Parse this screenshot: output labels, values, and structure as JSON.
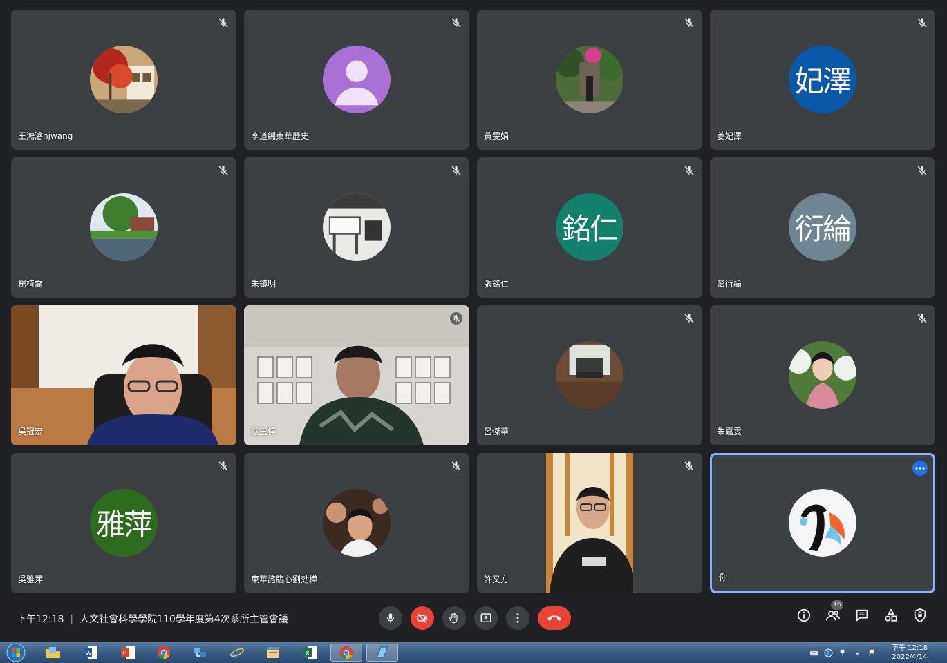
{
  "participants": [
    {
      "name": "王鴻濬hjwang",
      "muted": true,
      "avatar": "photo-tree-house"
    },
    {
      "name": "李道緗東華歷史",
      "muted": true,
      "avatar": "default-person",
      "color": "#a970d6"
    },
    {
      "name": "黃雯娟",
      "muted": true,
      "avatar": "photo-garden-person"
    },
    {
      "name": "姜妃澤",
      "muted": true,
      "initials": "妃澤",
      "color": "#0b57a8"
    },
    {
      "name": "楊植喬",
      "muted": true,
      "avatar": "photo-river-house"
    },
    {
      "name": "朱鎮明",
      "muted": true,
      "avatar": "photo-office"
    },
    {
      "name": "張銘仁",
      "muted": true,
      "initials": "銘仁",
      "color": "#12806b"
    },
    {
      "name": "彭衍綸",
      "muted": true,
      "initials": "衍綸",
      "color": "#6f8591"
    },
    {
      "name": "吳冠宏",
      "muted": false,
      "video": "man-glasses-office"
    },
    {
      "name": "蔡玉梓",
      "muted": true,
      "video": "man-gallery"
    },
    {
      "name": "呂傑華",
      "muted": true,
      "avatar": "photo-room"
    },
    {
      "name": "朱嘉雯",
      "muted": true,
      "avatar": "photo-woman-flowers"
    },
    {
      "name": "吳雅萍",
      "muted": true,
      "initials": "雅萍",
      "color": "#2e6b1f"
    },
    {
      "name": "東華諮臨心劉効樺",
      "muted": true,
      "avatar": "photo-man-smiling"
    },
    {
      "name": "許又方",
      "muted": true,
      "video": "man-peanuts-shirt"
    },
    {
      "name": "你",
      "muted": false,
      "self": true,
      "avatar": "penguin-logo"
    }
  ],
  "meeting": {
    "time": "下午12:18",
    "separator": "|",
    "title": "人文社會科學學院110學年度第4次系所主管會議"
  },
  "controls": [
    "microphone-icon",
    "camera-off-icon",
    "raise-hand-icon",
    "present-icon",
    "more-options-icon",
    "leave-call-icon"
  ],
  "right_tools": {
    "people_count": "16",
    "icons": [
      "info-icon",
      "people-icon",
      "chat-icon",
      "activities-icon",
      "host-controls-icon"
    ]
  },
  "taskbar": {
    "clock_time": "下午 12:18",
    "clock_date": "2022/4/14",
    "apps": [
      "explorer",
      "word",
      "powerpoint",
      "chrome",
      "network",
      "internet-explorer",
      "file-manager",
      "excel",
      "chrome-active",
      "app"
    ]
  },
  "colors": {
    "background": "#202124",
    "tile": "#3c4043",
    "accent": "#8ab4f8",
    "danger": "#ea4335"
  }
}
